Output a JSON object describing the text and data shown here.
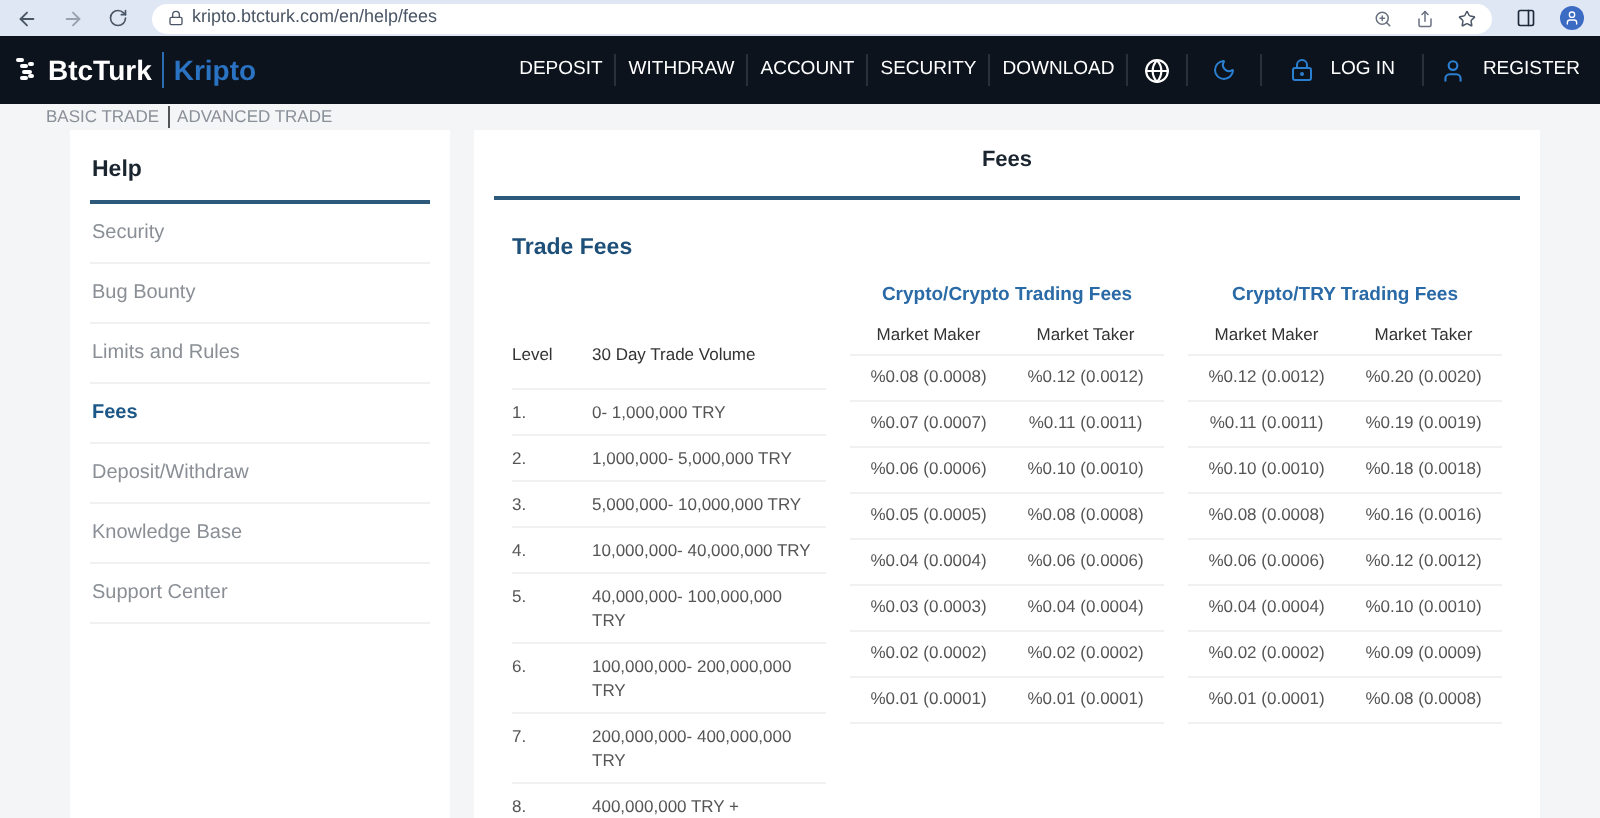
{
  "browser": {
    "url": "kripto.btcturk.com/en/help/fees"
  },
  "navbar": {
    "brand": "BtcTurk",
    "brand_sub": "Kripto",
    "items": [
      "DEPOSIT",
      "WITHDRAW",
      "ACCOUNT",
      "SECURITY",
      "DOWNLOAD"
    ],
    "login": "LOG IN",
    "register": "REGISTER"
  },
  "trade_switch": [
    "BASIC TRADE",
    "ADVANCED TRADE"
  ],
  "sidebar": {
    "title": "Help",
    "items": [
      {
        "label": "Security",
        "selected": false
      },
      {
        "label": "Bug Bounty",
        "selected": false
      },
      {
        "label": "Limits and Rules",
        "selected": false
      },
      {
        "label": "Fees",
        "selected": true
      },
      {
        "label": "Deposit/Withdraw",
        "selected": false
      },
      {
        "label": "Knowledge Base",
        "selected": false
      },
      {
        "label": "Support Center",
        "selected": false
      }
    ]
  },
  "main": {
    "title": "Fees",
    "section_title": "Trade Fees",
    "volume_table": {
      "columns": [
        "Level",
        "30 Day Trade Volume"
      ],
      "rows": [
        [
          "1.",
          "0- 1,000,000 TRY"
        ],
        [
          "2.",
          "1,000,000- 5,000,000 TRY"
        ],
        [
          "3.",
          "5,000,000- 10,000,000 TRY"
        ],
        [
          "4.",
          "10,000,000- 40,000,000 TRY"
        ],
        [
          "5.",
          "40,000,000- 100,000,000 TRY"
        ],
        [
          "6.",
          "100,000,000- 200,000,000 TRY"
        ],
        [
          "7.",
          "200,000,000- 400,000,000 TRY"
        ],
        [
          "8.",
          "400,000,000 TRY +"
        ]
      ]
    },
    "fee_tables": [
      {
        "title": "Crypto/Crypto Trading Fees",
        "columns": [
          "Market Maker",
          "Market Taker"
        ],
        "rows": [
          [
            "%0.08 (0.0008)",
            "%0.12 (0.0012)"
          ],
          [
            "%0.07 (0.0007)",
            "%0.11 (0.0011)"
          ],
          [
            "%0.06 (0.0006)",
            "%0.10 (0.0010)"
          ],
          [
            "%0.05 (0.0005)",
            "%0.08 (0.0008)"
          ],
          [
            "%0.04 (0.0004)",
            "%0.06 (0.0006)"
          ],
          [
            "%0.03 (0.0003)",
            "%0.04 (0.0004)"
          ],
          [
            "%0.02 (0.0002)",
            "%0.02 (0.0002)"
          ],
          [
            "%0.01 (0.0001)",
            "%0.01 (0.0001)"
          ]
        ]
      },
      {
        "title": "Crypto/TRY Trading Fees",
        "columns": [
          "Market Maker",
          "Market Taker"
        ],
        "rows": [
          [
            "%0.12 (0.0012)",
            "%0.20 (0.0020)"
          ],
          [
            "%0.11 (0.0011)",
            "%0.19 (0.0019)"
          ],
          [
            "%0.10 (0.0010)",
            "%0.18 (0.0018)"
          ],
          [
            "%0.08 (0.0008)",
            "%0.16 (0.0016)"
          ],
          [
            "%0.06 (0.0006)",
            "%0.12 (0.0012)"
          ],
          [
            "%0.04 (0.0004)",
            "%0.10 (0.0010)"
          ],
          [
            "%0.02 (0.0002)",
            "%0.09 (0.0009)"
          ],
          [
            "%0.01 (0.0001)",
            "%0.08 (0.0008)"
          ]
        ]
      }
    ]
  }
}
